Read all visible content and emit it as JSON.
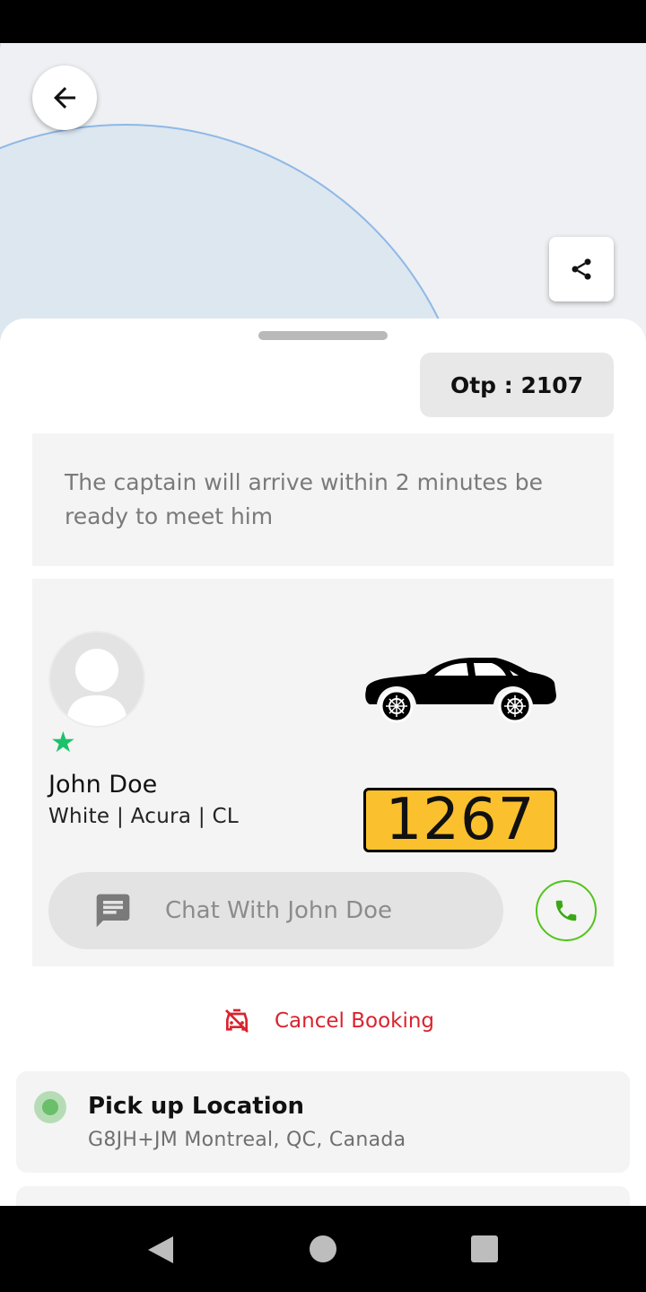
{
  "otp": {
    "label": "Otp : 2107"
  },
  "arrival_message": "The captain will arrive within 2 minutes be ready to meet him",
  "driver": {
    "name": "John Doe",
    "vehicle_info": "White | Acura | CL",
    "rating_icon": "star-icon",
    "plate_number": "1267",
    "chat_label": "Chat With John Doe"
  },
  "cancel": {
    "label": "Cancel Booking"
  },
  "pickup": {
    "title": "Pick up Location",
    "address": "G8JH+JM Montreal, QC, Canada"
  },
  "colors": {
    "accent_green": "#1cc16a",
    "call_green": "#52c41a",
    "cancel_red": "#d9232e",
    "plate_yellow": "#fbc02d",
    "map_circle": "#dde7f0"
  }
}
